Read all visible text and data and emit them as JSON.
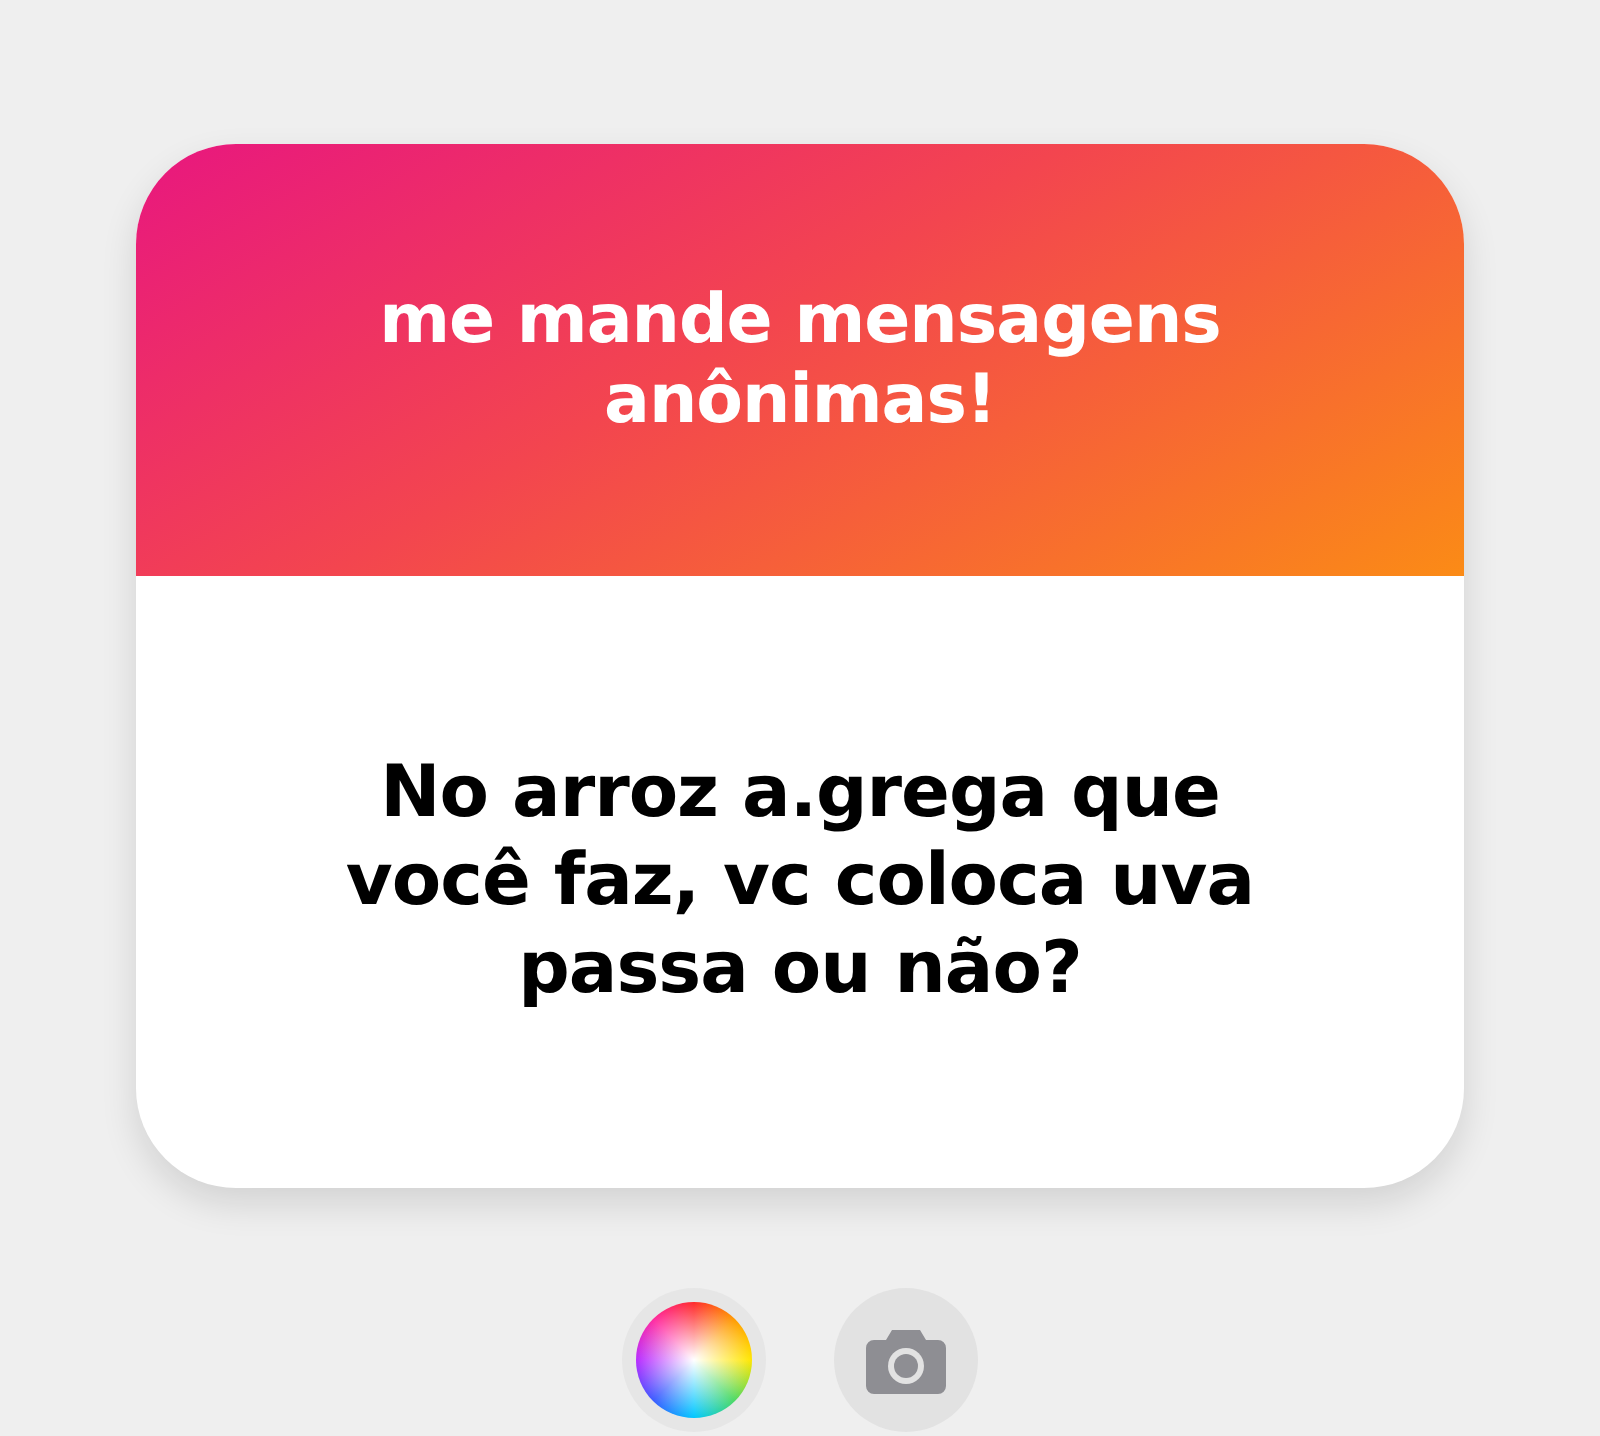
{
  "card": {
    "title": "me mande mensagens anônimas!",
    "question": "No arroz a.grega que você faz, vc coloca uva passa ou não?"
  },
  "tools": [
    {
      "kind": "color-wheel"
    },
    {
      "kind": "camera"
    }
  ]
}
